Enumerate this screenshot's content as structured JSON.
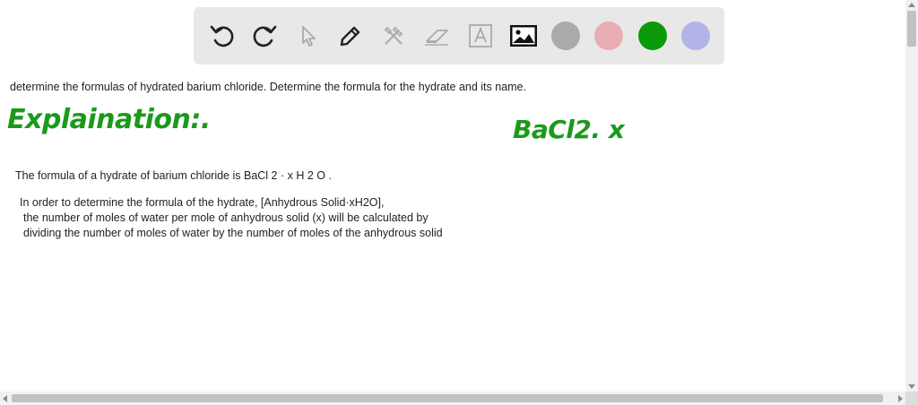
{
  "toolbar": {
    "tools": [
      {
        "name": "undo-icon"
      },
      {
        "name": "redo-icon"
      },
      {
        "name": "pointer-icon"
      },
      {
        "name": "pen-icon"
      },
      {
        "name": "tools-icon"
      },
      {
        "name": "eraser-icon"
      },
      {
        "name": "text-icon"
      },
      {
        "name": "image-icon"
      }
    ],
    "colors": {
      "gray": "#aaaaaa",
      "pink": "#e8adb3",
      "green": "#0a9a0a",
      "lavender": "#b3b3e8"
    }
  },
  "content": {
    "question": "determine the formulas of hydrated barium chloride. Determine the formula for the hydrate and its name.",
    "handwritten_heading": "Explaination:.",
    "handwritten_formula": "BaCl2. x",
    "line1": "The formula of a hydrate of barium chloride is BaCl 2 · x H 2 O .",
    "line2": "In order to determine the formula of the hydrate, [Anhydrous Solid·xH2O],",
    "line3": "the number of moles of water per mole of anhydrous solid (x) will be calculated by",
    "line4": "dividing the number of moles of water by the number of moles of the anhydrous solid"
  },
  "colors": {
    "ink_green": "#1a9a1a",
    "toolbar_bg": "#e8e8e8"
  }
}
